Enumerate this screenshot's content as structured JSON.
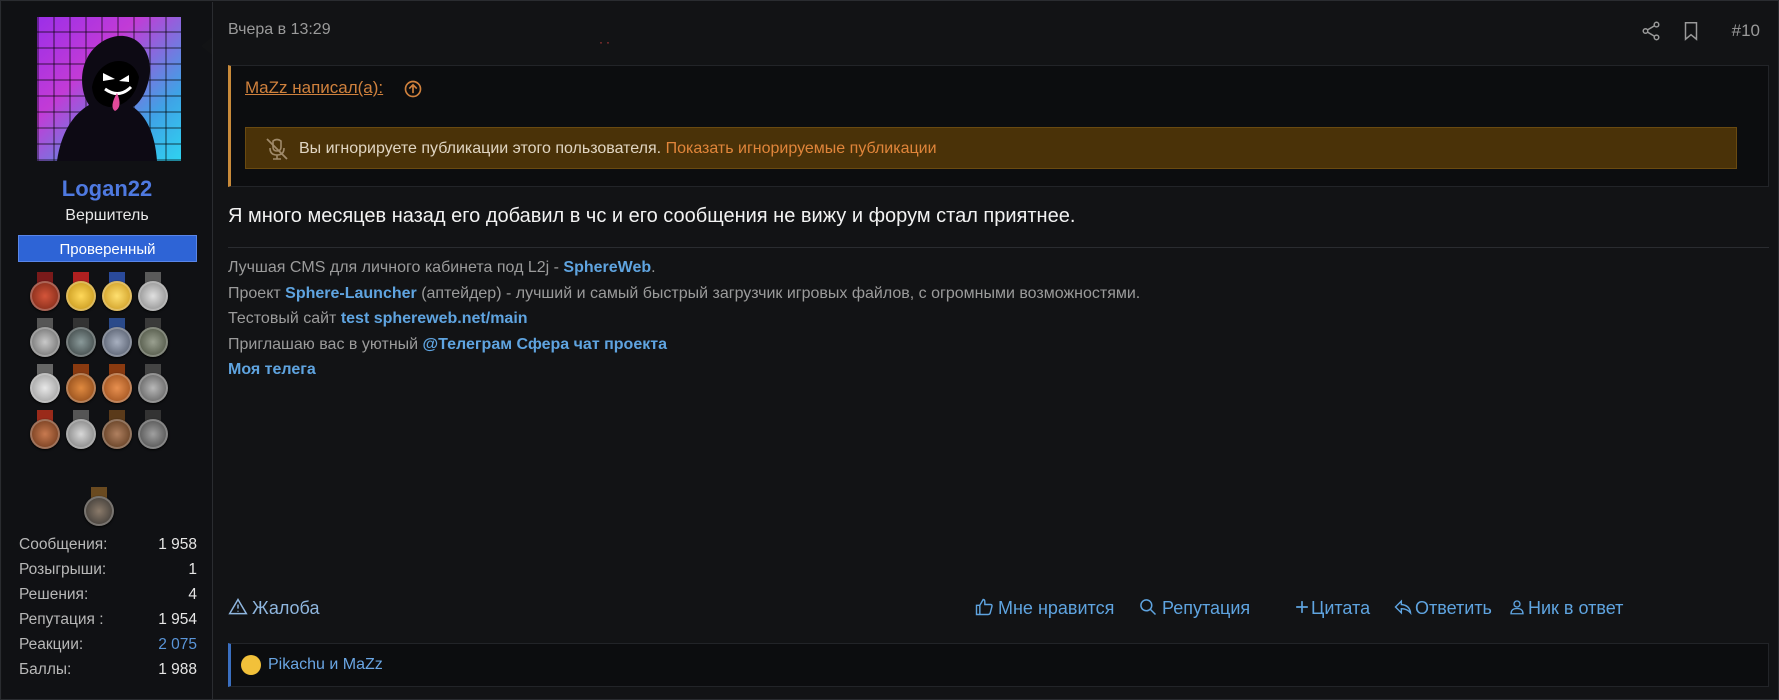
{
  "user": {
    "name": "Logan22",
    "title": "Вершитель",
    "badge": "Проверенный",
    "stats": [
      {
        "label": "Сообщения:",
        "value": "1 958",
        "link": false
      },
      {
        "label": "Розыгрыши:",
        "value": "1",
        "link": false
      },
      {
        "label": "Решения:",
        "value": "4",
        "link": false
      },
      {
        "label": "Репутация :",
        "value": "1 954",
        "link": false
      },
      {
        "label": "Реакции:",
        "value": "2 075",
        "link": true
      },
      {
        "label": "Баллы:",
        "value": "1 988",
        "link": false
      }
    ]
  },
  "post": {
    "date": "Вчера в 13:29",
    "number": "#10",
    "quote": {
      "author_line": "MaZz написал(а):",
      "ignored_text": "Вы игнорируете публикации этого пользователя.",
      "ignored_link": "Показать игнорируемые публикации"
    },
    "message": "Я много месяцев назад его добавил в чс и его сообщения не вижу и форум стал приятнее.",
    "signature": {
      "line1_prefix": "Лучшая CMS для личного кабинета под L2j - ",
      "line1_link": "SphereWeb",
      "line1_suffix": ".",
      "line2_prefix": "Проект ",
      "line2_link": "Sphere-Launcher",
      "line2_suffix": " (аптейдер) - лучший и самый быстрый загрузчик игровых файлов, с огромными возможностями.",
      "line3_prefix": "Тестовый сайт ",
      "line3_link": "test sphereweb.net/main",
      "line4_prefix": "Приглашаю вас в уютный ",
      "line4_link": "@Телеграм Сфера чат проекта",
      "line5_link": "Моя телега"
    },
    "actions": {
      "report": "Жалоба",
      "like": "Мне нравится",
      "reputation": "Репутация",
      "quote": "Цитата",
      "reply": "Ответить",
      "nick": "Ник в ответ"
    },
    "reactions_text": "Pikachu и MaZz"
  },
  "colors": {
    "accent_link": "#5fa4e0",
    "username": "#4e79e0",
    "quote_border": "#c88a3a",
    "ignored_bg": "#4a3208"
  },
  "icons": [
    "share-icon",
    "bookmark-icon",
    "arrow-up-circle-icon",
    "mute-icon",
    "warning-icon",
    "thumbs-up-icon",
    "search-icon",
    "plus-icon",
    "reply-icon",
    "user-icon"
  ]
}
